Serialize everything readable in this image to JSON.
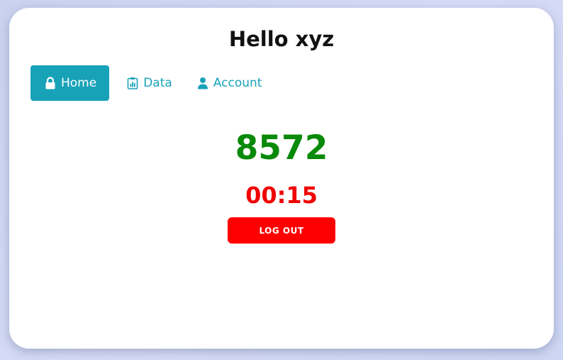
{
  "header": {
    "greeting": "Hello xyz"
  },
  "nav": {
    "tabs": [
      {
        "label": "Home",
        "icon": "lock-icon",
        "active": true
      },
      {
        "label": "Data",
        "icon": "clipboard-chart-icon",
        "active": false
      },
      {
        "label": "Account",
        "icon": "user-icon",
        "active": false
      }
    ]
  },
  "main": {
    "counter": "8572",
    "timer": "00:15",
    "logout_label": "LOG OUT"
  },
  "colors": {
    "accent": "#17a2b8",
    "counter": "#0a8a0a",
    "timer": "#f00000",
    "logout": "#ff0000"
  }
}
